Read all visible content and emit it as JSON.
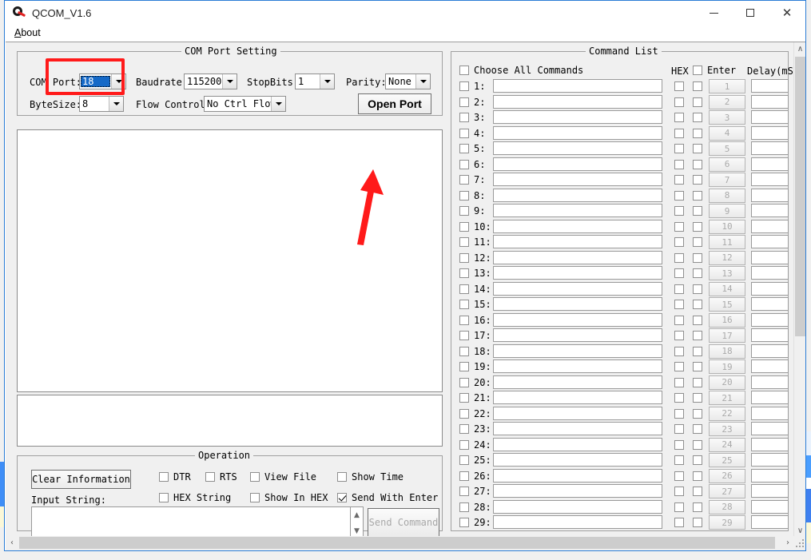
{
  "window": {
    "title": "QCOM_V1.6",
    "icon": "qcom-logo-icon",
    "controls": {
      "minimize": "─",
      "maximize": "□",
      "close": "✕"
    }
  },
  "menubar": {
    "items": [
      {
        "label": "About",
        "mnemonic": "A",
        "rest": "bout"
      }
    ]
  },
  "com_port_setting": {
    "caption": "COM Port Setting",
    "fields": {
      "com_port_label": "COM Port:",
      "com_port_value": "18",
      "baudrate_label": "Baudrate:",
      "baudrate_value": "115200",
      "stopbits_label": "StopBits:",
      "stopbits_value": "1",
      "parity_label": "Parity:",
      "parity_value": "None",
      "bytesize_label": "ByteSize:",
      "bytesize_value": "8",
      "flow_control_label": "Flow Control:",
      "flow_control_value": "No Ctrl Flow"
    },
    "open_port_button": "Open Port"
  },
  "terminal": {
    "main_output": "",
    "secondary_output": ""
  },
  "operation": {
    "caption": "Operation",
    "clear_button": "Clear Information",
    "input_string_label": "Input String:",
    "input_string_value": "",
    "send_command_button": "Send Command",
    "checkboxes": [
      {
        "label": "DTR",
        "checked": false
      },
      {
        "label": "RTS",
        "checked": false
      },
      {
        "label": "View File",
        "checked": false
      },
      {
        "label": "Show Time",
        "checked": false
      },
      {
        "label": "HEX String",
        "checked": false
      },
      {
        "label": "Show In HEX",
        "checked": false
      },
      {
        "label": "Send With Enter",
        "checked": true
      }
    ]
  },
  "command_list": {
    "caption": "Command List",
    "choose_all_label": "Choose All Commands",
    "choose_all_checked": false,
    "col_hex": "HEX",
    "col_enter": "Enter",
    "col_enter_checked": false,
    "col_delay": "Delay(mS)",
    "rows": [
      {
        "num": "1:",
        "btn": "1",
        "cmd": "",
        "delay": "",
        "checked": false,
        "hex": false,
        "enter": false
      },
      {
        "num": "2:",
        "btn": "2",
        "cmd": "",
        "delay": "",
        "checked": false,
        "hex": false,
        "enter": false
      },
      {
        "num": "3:",
        "btn": "3",
        "cmd": "",
        "delay": "",
        "checked": false,
        "hex": false,
        "enter": false
      },
      {
        "num": "4:",
        "btn": "4",
        "cmd": "",
        "delay": "",
        "checked": false,
        "hex": false,
        "enter": false
      },
      {
        "num": "5:",
        "btn": "5",
        "cmd": "",
        "delay": "",
        "checked": false,
        "hex": false,
        "enter": false
      },
      {
        "num": "6:",
        "btn": "6",
        "cmd": "",
        "delay": "",
        "checked": false,
        "hex": false,
        "enter": false
      },
      {
        "num": "7:",
        "btn": "7",
        "cmd": "",
        "delay": "",
        "checked": false,
        "hex": false,
        "enter": false
      },
      {
        "num": "8:",
        "btn": "8",
        "cmd": "",
        "delay": "",
        "checked": false,
        "hex": false,
        "enter": false
      },
      {
        "num": "9:",
        "btn": "9",
        "cmd": "",
        "delay": "",
        "checked": false,
        "hex": false,
        "enter": false
      },
      {
        "num": "10:",
        "btn": "10",
        "cmd": "",
        "delay": "",
        "checked": false,
        "hex": false,
        "enter": false
      },
      {
        "num": "11:",
        "btn": "11",
        "cmd": "",
        "delay": "",
        "checked": false,
        "hex": false,
        "enter": false
      },
      {
        "num": "12:",
        "btn": "12",
        "cmd": "",
        "delay": "",
        "checked": false,
        "hex": false,
        "enter": false
      },
      {
        "num": "13:",
        "btn": "13",
        "cmd": "",
        "delay": "",
        "checked": false,
        "hex": false,
        "enter": false
      },
      {
        "num": "14:",
        "btn": "14",
        "cmd": "",
        "delay": "",
        "checked": false,
        "hex": false,
        "enter": false
      },
      {
        "num": "15:",
        "btn": "15",
        "cmd": "",
        "delay": "",
        "checked": false,
        "hex": false,
        "enter": false
      },
      {
        "num": "16:",
        "btn": "16",
        "cmd": "",
        "delay": "",
        "checked": false,
        "hex": false,
        "enter": false
      },
      {
        "num": "17:",
        "btn": "17",
        "cmd": "",
        "delay": "",
        "checked": false,
        "hex": false,
        "enter": false
      },
      {
        "num": "18:",
        "btn": "18",
        "cmd": "",
        "delay": "",
        "checked": false,
        "hex": false,
        "enter": false
      },
      {
        "num": "19:",
        "btn": "19",
        "cmd": "",
        "delay": "",
        "checked": false,
        "hex": false,
        "enter": false
      },
      {
        "num": "20:",
        "btn": "20",
        "cmd": "",
        "delay": "",
        "checked": false,
        "hex": false,
        "enter": false
      },
      {
        "num": "21:",
        "btn": "21",
        "cmd": "",
        "delay": "",
        "checked": false,
        "hex": false,
        "enter": false
      },
      {
        "num": "22:",
        "btn": "22",
        "cmd": "",
        "delay": "",
        "checked": false,
        "hex": false,
        "enter": false
      },
      {
        "num": "23:",
        "btn": "23",
        "cmd": "",
        "delay": "",
        "checked": false,
        "hex": false,
        "enter": false
      },
      {
        "num": "24:",
        "btn": "24",
        "cmd": "",
        "delay": "",
        "checked": false,
        "hex": false,
        "enter": false
      },
      {
        "num": "25:",
        "btn": "25",
        "cmd": "",
        "delay": "",
        "checked": false,
        "hex": false,
        "enter": false
      },
      {
        "num": "26:",
        "btn": "26",
        "cmd": "",
        "delay": "",
        "checked": false,
        "hex": false,
        "enter": false
      },
      {
        "num": "27:",
        "btn": "27",
        "cmd": "",
        "delay": "",
        "checked": false,
        "hex": false,
        "enter": false
      },
      {
        "num": "28:",
        "btn": "28",
        "cmd": "",
        "delay": "",
        "checked": false,
        "hex": false,
        "enter": false
      },
      {
        "num": "29:",
        "btn": "29",
        "cmd": "",
        "delay": "",
        "checked": false,
        "hex": false,
        "enter": false
      }
    ]
  },
  "scrollbars": {
    "vertical": {
      "up": "∧",
      "down": "∨"
    },
    "horizontal": {
      "left": "‹",
      "right": "›"
    }
  },
  "annotations": {
    "highlight_target": "com-port-combo",
    "arrow_target": "open-port-button",
    "color": "#ff1a1a"
  }
}
